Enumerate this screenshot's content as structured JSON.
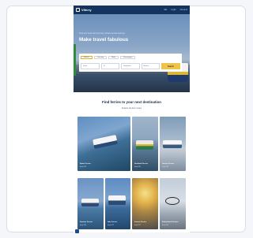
{
  "site": {
    "brand": "Viferry",
    "nav": [
      "EN",
      "Login",
      "Account"
    ]
  },
  "hero": {
    "subtitle": "Find and book the best ferry tickets across Europe",
    "title": "Make travel fabulous",
    "search": {
      "tabs": [
        "Return",
        "One way",
        "Multi",
        "Passengers"
      ],
      "fields": [
        "From",
        "To",
        "Departure",
        "Return"
      ],
      "button_label": "Search"
    }
  },
  "destinations": {
    "title": "Find ferries to your next destination",
    "subtitle": "Explore top ferry routes",
    "items": [
      {
        "name": "Spain Ferries",
        "from": "from €29"
      },
      {
        "name": "Scotland Ferries",
        "from": "from €25"
      },
      {
        "name": "Greece Ferries",
        "from": "from €19"
      },
      {
        "name": "Sweden Ferries",
        "from": "from €35"
      },
      {
        "name": "Italy Ferries",
        "from": "from €22"
      },
      {
        "name": "France Ferries",
        "from": "from €27"
      },
      {
        "name": "Netherlands Ferries",
        "from": "from €31"
      }
    ]
  },
  "colors": {
    "header": "#14335e",
    "accent": "#efc44a",
    "link": "#3f5b86"
  }
}
